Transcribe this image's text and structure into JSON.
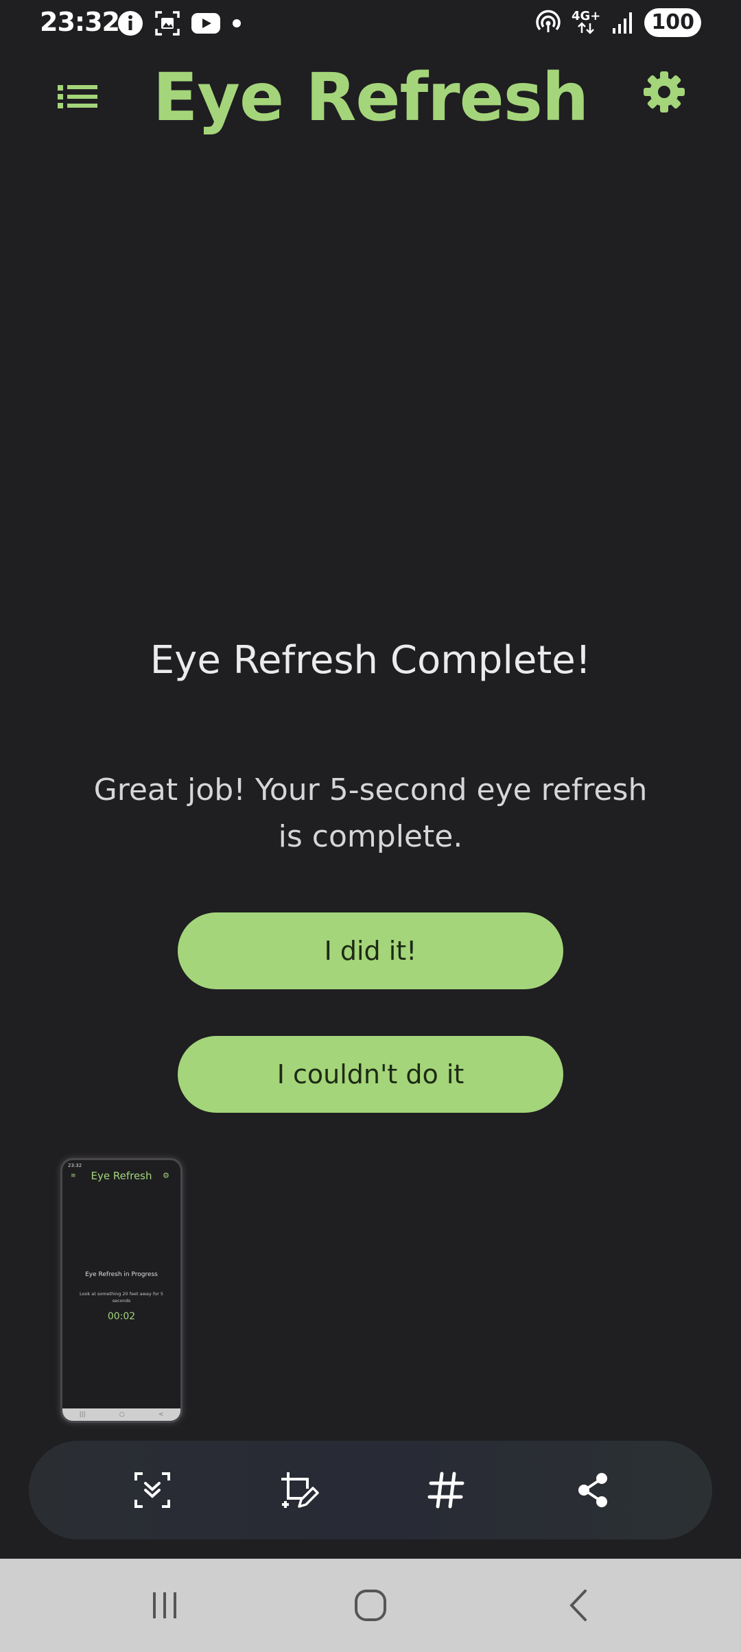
{
  "status_bar": {
    "time": "23:32",
    "battery": "100",
    "network": "4G+",
    "icons_left": [
      "info-icon",
      "screenshot-icon",
      "youtube-icon",
      "dot-icon"
    ],
    "icons_right": [
      "hotspot-icon",
      "network-4g-icon",
      "signal-icon",
      "battery-icon"
    ]
  },
  "app_bar": {
    "title": "Eye Refresh",
    "menu_icon": "list-icon",
    "settings_icon": "gear-icon"
  },
  "colors": {
    "accent": "#a4d57a",
    "background": "#1f1e21",
    "button_text": "#1d2a14"
  },
  "content": {
    "title": "Eye Refresh Complete!",
    "message": "Great job! Your 5-second eye refresh is complete.",
    "did_it_label": "I did it!",
    "couldnt_label": "I couldn't do it"
  },
  "thumbnail": {
    "status_time": "23:32",
    "title": "Eye Refresh",
    "heading": "Eye Refresh in Progress",
    "subtext": "Look at something 20 feet away for 5 seconds",
    "timer": "00:02"
  },
  "toolbar": {
    "icons": [
      "scroll-capture-icon",
      "crop-edit-icon",
      "hashtag-icon",
      "share-icon"
    ]
  },
  "nav_bar": {
    "icons": [
      "recents-icon",
      "home-icon",
      "back-icon"
    ]
  }
}
